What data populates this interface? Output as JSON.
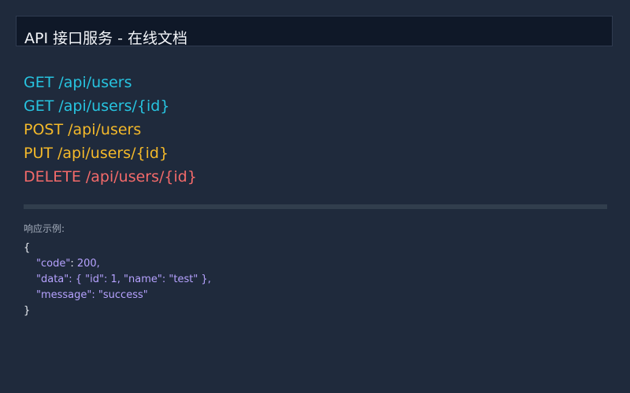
{
  "header": {
    "title": "API 接口服务 - 在线文档"
  },
  "endpoints": [
    {
      "label": "GET /api/users",
      "color": "#27c4e0"
    },
    {
      "label": "GET /api/users/{id}",
      "color": "#27c4e0"
    },
    {
      "label": "POST /api/users",
      "color": "#f4b92a"
    },
    {
      "label": "PUT /api/users/{id}",
      "color": "#f4b92a"
    },
    {
      "label": "DELETE /api/users/{id}",
      "color": "#f36a6a"
    }
  ],
  "response": {
    "label": "响应示例:",
    "open_brace": "{",
    "line1_key": "\"code\"",
    "line1_sep": ": ",
    "line1_value": "200,",
    "line2_key": "\"data\"",
    "line2_rest": ": { \"id\": 1, \"name\": \"test\" },",
    "line3_key": "\"message\"",
    "line3_rest": ": \"success\"",
    "close_brace": "}"
  },
  "colors": {
    "background": "#1f2a3c",
    "header_bg": "#0f1828",
    "json_accent": "#b6a2ff"
  }
}
